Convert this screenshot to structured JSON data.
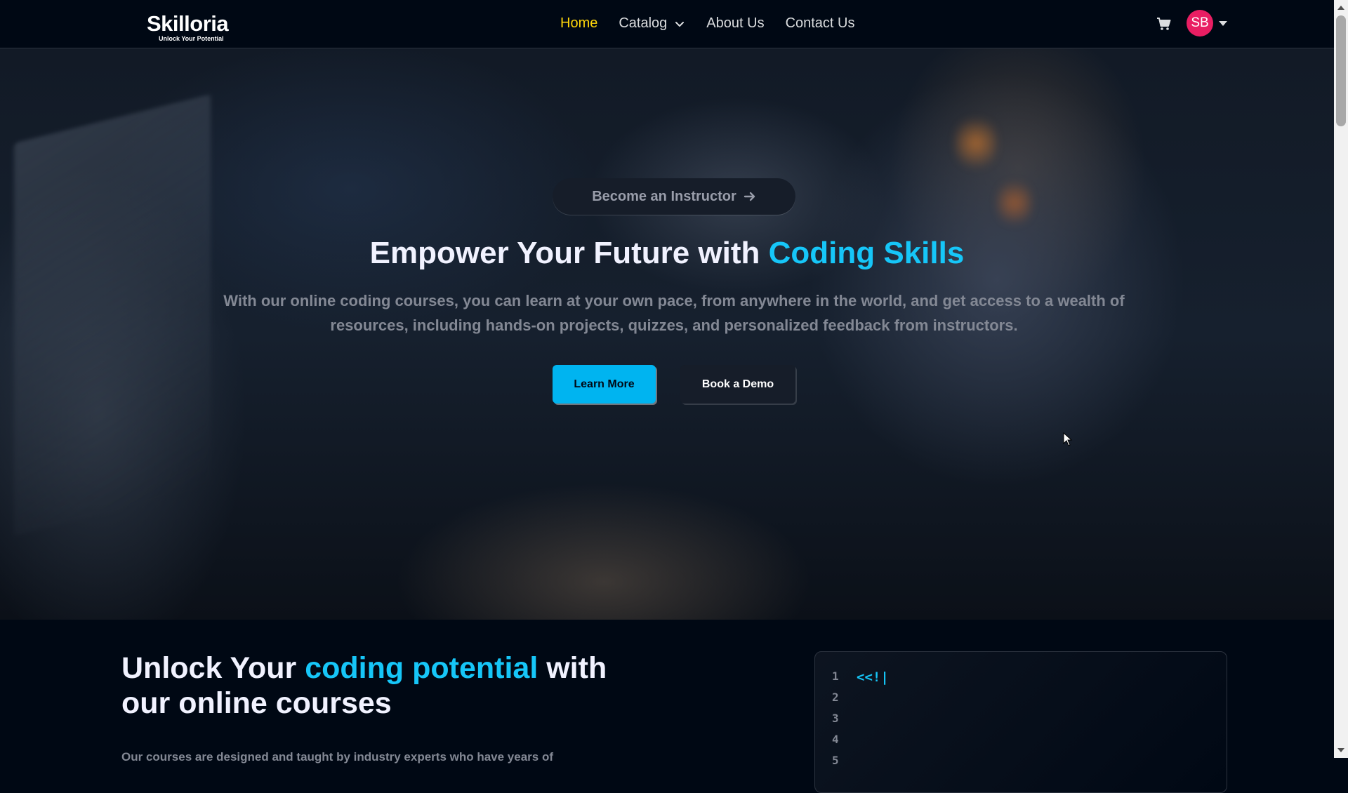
{
  "brand": {
    "name": "Skilloria",
    "tagline": "Unlock Your Potential"
  },
  "nav": {
    "links": [
      {
        "label": "Home",
        "active": true
      },
      {
        "label": "Catalog",
        "has_dropdown": true
      },
      {
        "label": "About Us"
      },
      {
        "label": "Contact Us"
      }
    ],
    "cart_icon": "cart-icon",
    "user_initials": "SB",
    "avatar_color": "#e91e63",
    "active_color": "#ffd60a"
  },
  "hero": {
    "instructor_pill": "Become an Instructor",
    "headline_prefix": "Empower Your Future with ",
    "headline_highlight": "Coding Skills",
    "subtitle": "With our online coding courses, you can learn at your own pace, from anywhere in the world, and get access to a wealth of resources, including hands-on projects, quizzes, and personalized feedback from instructors.",
    "primary_button": "Learn More",
    "secondary_button": "Book a Demo",
    "accent_color": "#16c6f8"
  },
  "section2": {
    "title_prefix": "Unlock Your ",
    "title_highlight": "coding potential",
    "title_suffix": " with our online courses",
    "description": "Our courses are designed and taught by industry experts who have years of",
    "code_lines": [
      "1",
      "2",
      "3",
      "4",
      "5"
    ],
    "code_text": "<<!|"
  }
}
